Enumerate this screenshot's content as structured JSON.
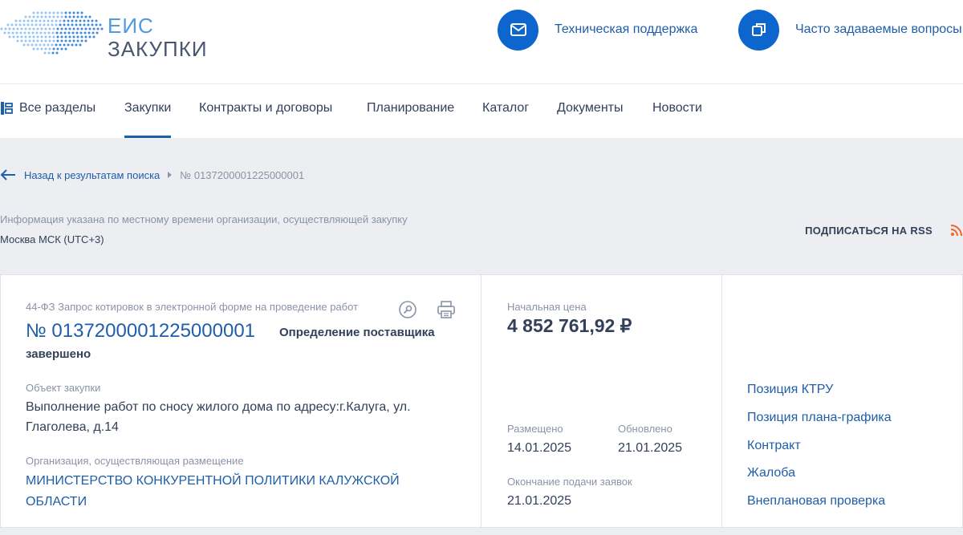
{
  "header": {
    "logo_line1": "ЕИС",
    "logo_line2": "ЗАКУПКИ",
    "support_label": "Техническая поддержка",
    "faq_label": "Часто задаваемые вопросы"
  },
  "nav": {
    "all_sections": "Все разделы",
    "items": [
      "Закупки",
      "Контракты и договоры",
      "Планирование",
      "Каталог",
      "Документы",
      "Новости"
    ],
    "active": "Закупки"
  },
  "breadcrumb": {
    "back_label": "Назад к результатам поиска",
    "current": "№ 0137200001225000001"
  },
  "timezone": {
    "note": "Информация указана по местному времени организации, осуществляющей закупку",
    "value": "Москва МСК (UTC+3)"
  },
  "rss_label": "ПОДПИСАТЬСЯ НА RSS",
  "purchase": {
    "law_type": "44-ФЗ Запрос котировок в электронной форме на проведение работ",
    "number": "№ 0137200001225000001",
    "status": "Определение поставщика завершено",
    "object_label": "Объект закупки",
    "object_value": "Выполнение работ по сносу жилого дома по адресу:г.Калуга, ул. Глаголева, д.14",
    "org_label": "Организация, осуществляющая размещение",
    "org_value": "МИНИСТЕРСТВО КОНКУРЕНТНОЙ ПОЛИТИКИ КАЛУЖСКОЙ ОБЛАСТИ",
    "price_label": "Начальная цена",
    "price_value": "4 852 761,92 ₽",
    "posted_label": "Размещено",
    "posted_value": "14.01.2025",
    "updated_label": "Обновлено",
    "updated_value": "21.01.2025",
    "deadline_label": "Окончание подачи заявок",
    "deadline_value": "21.01.2025"
  },
  "side_links": [
    "Позиция КТРУ",
    "Позиция плана-графика",
    "Контракт",
    "Жалоба",
    "Внеплановая проверка"
  ],
  "colors": {
    "accent": "#1f5ea8",
    "icon_circle": "#0d65ce",
    "rss": "#f26522",
    "muted": "#8a93a6",
    "text": "#334059",
    "page_bg": "#eceef2"
  }
}
